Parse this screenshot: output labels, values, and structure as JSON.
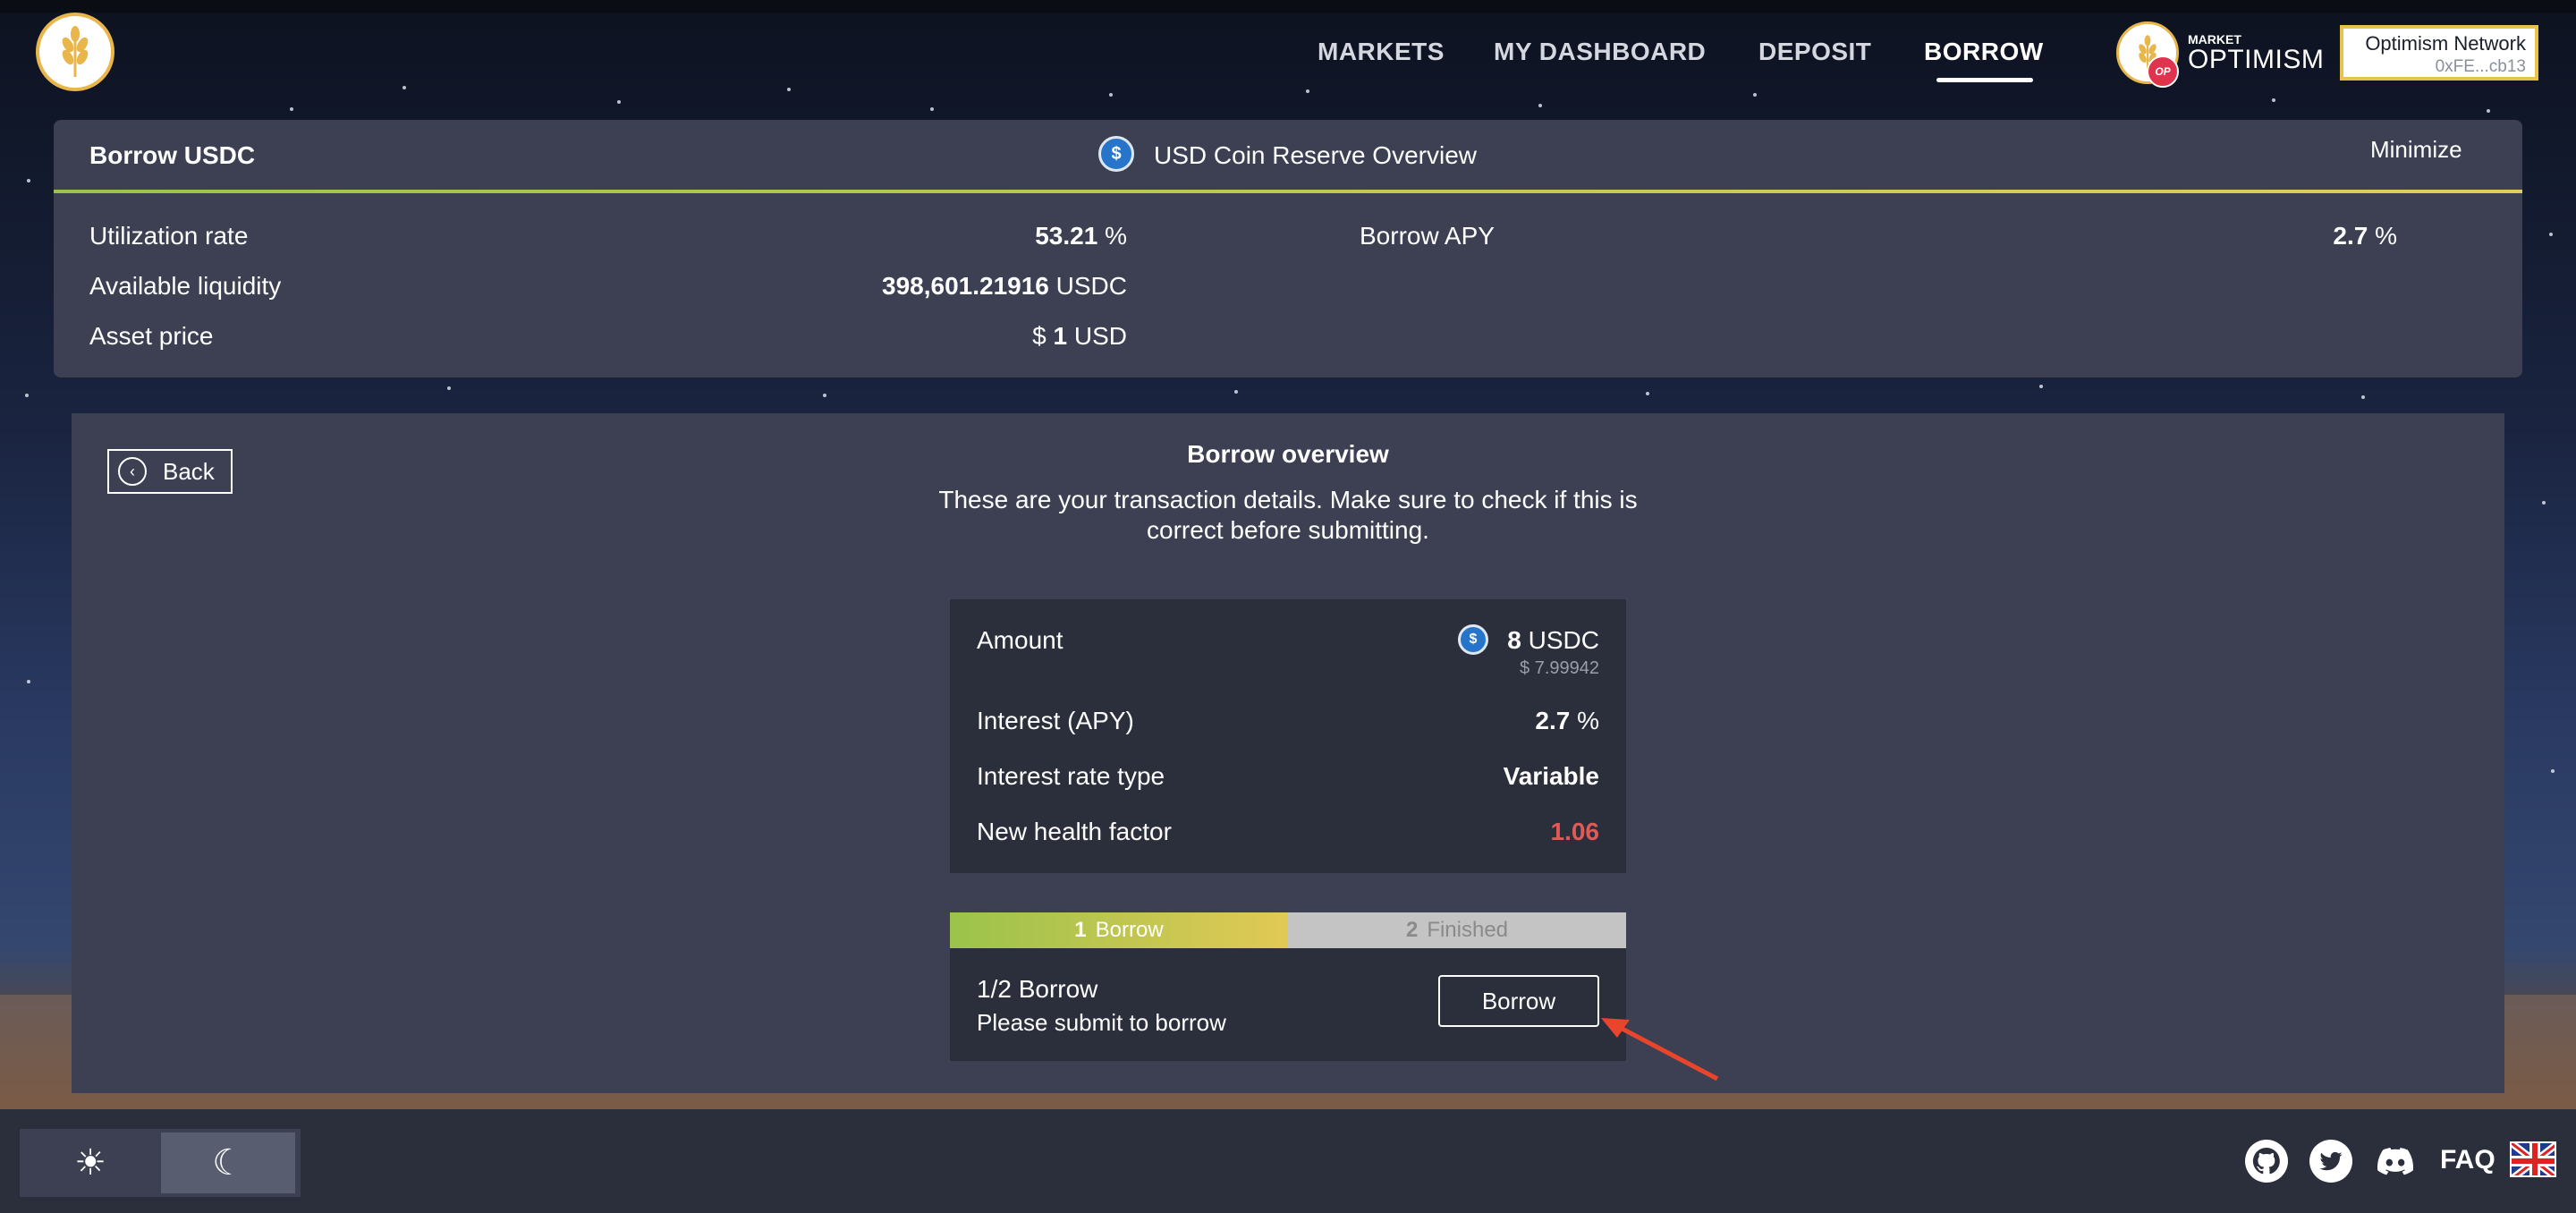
{
  "nav": {
    "items": [
      {
        "label": "MARKETS"
      },
      {
        "label": "MY DASHBOARD"
      },
      {
        "label": "DEPOSIT"
      },
      {
        "label": "BORROW"
      }
    ]
  },
  "market": {
    "small": "MARKET",
    "name": "OPTIMISM",
    "badge": "OP"
  },
  "network": {
    "name": "Optimism Network",
    "address": "0xFE...cb13"
  },
  "reserve": {
    "title": "Borrow USDC",
    "overview_title": "USD Coin Reserve Overview",
    "minimize": "Minimize",
    "rows": {
      "utilization": {
        "label": "Utilization rate",
        "value": "53.21",
        "unit": "%"
      },
      "liquidity": {
        "label": "Available liquidity",
        "value": "398,601.21916",
        "unit": "USDC"
      },
      "price": {
        "label": "Asset price",
        "prefix": "$",
        "value": "1",
        "unit": "USD"
      },
      "apy": {
        "label": "Borrow APY",
        "value": "2.7",
        "unit": "%"
      }
    }
  },
  "overview": {
    "back": "Back",
    "title": "Borrow overview",
    "description": "These are your transaction details. Make sure to check if this is correct before submitting.",
    "amount": {
      "label": "Amount",
      "value": "8",
      "unit": "USDC",
      "usd": "$ 7.99942"
    },
    "interest": {
      "label": "Interest (APY)",
      "value": "2.7",
      "unit": "%"
    },
    "rate_type": {
      "label": "Interest rate type",
      "value": "Variable"
    },
    "health": {
      "label": "New health factor",
      "value": "1.06"
    }
  },
  "steps": [
    {
      "num": "1",
      "label": "Borrow"
    },
    {
      "num": "2",
      "label": "Finished"
    }
  ],
  "action": {
    "step": "1/2 Borrow",
    "hint": "Please submit to borrow",
    "button": "Borrow"
  },
  "footer": {
    "faq": "FAQ",
    "icons": [
      "github-icon",
      "twitter-icon",
      "discord-icon"
    ]
  }
}
